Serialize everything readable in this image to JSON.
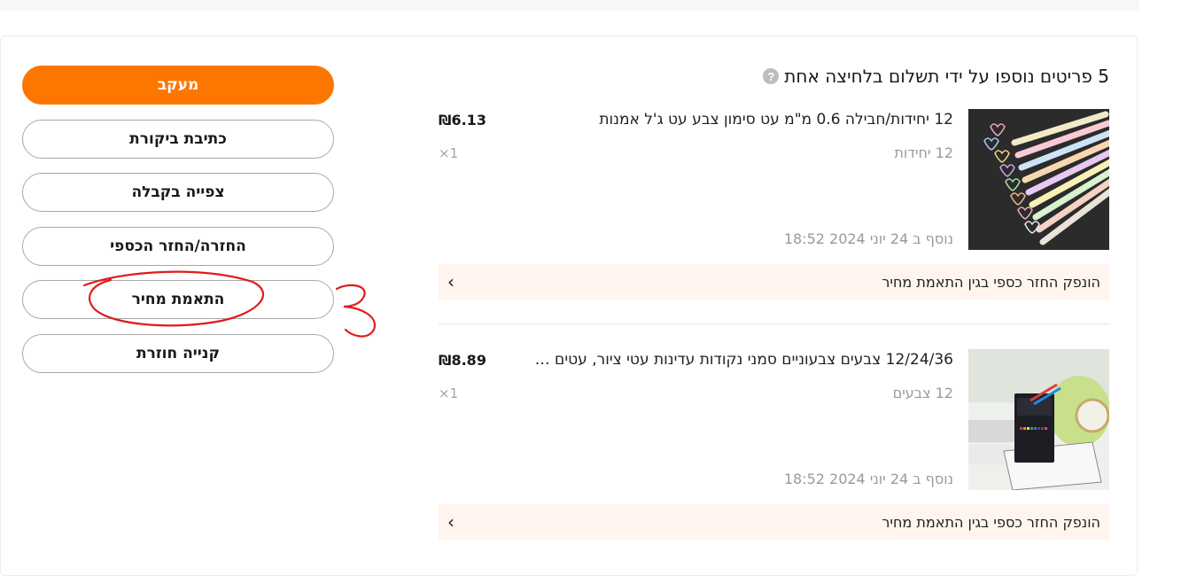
{
  "header": {
    "title": "5 פריטים נוספו על ידי תשלום בלחיצה אחת",
    "help_icon": "?"
  },
  "items": [
    {
      "title": "12 יחידות/חבילה 0.6 מ\"מ עט סימון צבע עט ג'ל אמנות",
      "price": "₪6.13",
      "variant": "12 יחידות",
      "quantity": "×1",
      "added_date": "נוסף ב 24 יוני 2024 18:52",
      "refund_text": "הונפק החזר כספי בגין התאמת מחיר",
      "image": "gel-pens-product-image"
    },
    {
      "title": "12/24/36 צבעים צבעוניים סמני נקודות עדינות עטי ציור, עטים ל...",
      "price": "₪8.89",
      "variant": "12 צבעים",
      "quantity": "×1",
      "added_date": "נוסף ב 24 יוני 2024 18:52",
      "refund_text": "הונפק החזר כספי בגין התאמת מחיר",
      "image": "markers-product-image"
    }
  ],
  "actions": {
    "track": "מעקב",
    "review": "כתיבת ביקורת",
    "view_receipt": "צפייה בקבלה",
    "return_refund": "החזרה/החזר הכספי",
    "price_adjust": "התאמת מחיר",
    "buy_again": "קנייה חוזרת"
  },
  "annotation": {
    "mark": "3",
    "color": "#e01b1b"
  },
  "colors": {
    "accent": "#fd7700",
    "refund_bg": "#fff4ee",
    "muted_text": "#9a9a9a"
  }
}
